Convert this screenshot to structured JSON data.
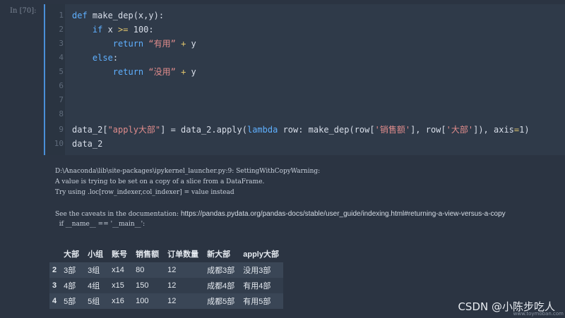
{
  "cell": {
    "prompt": "In [70]:"
  },
  "code_lines": [
    {
      "n": "1",
      "parts": [
        [
          "kw",
          "def "
        ],
        [
          "",
          "make_dep(x,y):"
        ]
      ]
    },
    {
      "n": "2",
      "parts": [
        [
          "",
          "    "
        ],
        [
          "kw",
          "if "
        ],
        [
          "",
          "x "
        ],
        [
          "op",
          ">="
        ],
        [
          "",
          " 100:"
        ]
      ]
    },
    {
      "n": "3",
      "parts": [
        [
          "",
          "        "
        ],
        [
          "kw",
          "return "
        ],
        [
          "str",
          "“有用”"
        ],
        [
          "",
          " "
        ],
        [
          "op",
          "+"
        ],
        [
          "",
          " y"
        ]
      ]
    },
    {
      "n": "4",
      "parts": [
        [
          "",
          "    "
        ],
        [
          "kw",
          "else"
        ],
        [
          "",
          ":"
        ]
      ]
    },
    {
      "n": "5",
      "parts": [
        [
          "",
          "        "
        ],
        [
          "kw",
          "return "
        ],
        [
          "str",
          "“没用”"
        ],
        [
          "",
          " "
        ],
        [
          "op",
          "+"
        ],
        [
          "",
          " y"
        ]
      ]
    },
    {
      "n": "6",
      "parts": []
    },
    {
      "n": "7",
      "parts": []
    },
    {
      "n": "8",
      "parts": []
    },
    {
      "n": "9",
      "parts": [
        [
          "",
          "data_2["
        ],
        [
          "str",
          "\"apply大部\""
        ],
        [
          "",
          "] = data_2.apply("
        ],
        [
          "kw",
          "lambda "
        ],
        [
          "",
          "row: make_dep(row["
        ],
        [
          "str",
          "'销售额'"
        ],
        [
          "",
          "], row["
        ],
        [
          "str",
          "'大部'"
        ],
        [
          "",
          "]), axis"
        ],
        [
          "op",
          "="
        ],
        [
          "",
          "1)"
        ]
      ]
    },
    {
      "n": "10",
      "parts": [
        [
          "",
          "data_2"
        ]
      ]
    }
  ],
  "output": {
    "warning_lines": [
      "D:\\Anaconda\\lib\\site-packages\\ipykernel_launcher.py:9: SettingWithCopyWarning:",
      "A value is trying to be set on a copy of a slice from a DataFrame.",
      "Try using .loc[row_indexer,col_indexer] = value instead"
    ],
    "caveat_prefix": "See the caveats in the documentation: ",
    "caveat_url": "https://pandas.pydata.org/pandas-docs/stable/user_guide/indexing.html#returning-a-view-versus-a-copy",
    "main_line": "  if __name__ == '__main__':"
  },
  "dataframe": {
    "columns": [
      "",
      "大部",
      "小组",
      "账号",
      "销售额",
      "订单数量",
      "新大部",
      "apply大部"
    ],
    "rows": [
      [
        "2",
        "3部",
        "3组",
        "x14",
        "80",
        "12",
        "成都3部",
        "没用3部"
      ],
      [
        "3",
        "4部",
        "4组",
        "x15",
        "150",
        "12",
        "成都4部",
        "有用4部"
      ],
      [
        "4",
        "5部",
        "5组",
        "x16",
        "100",
        "12",
        "成都5部",
        "有用5部"
      ]
    ]
  },
  "watermark": {
    "text": "CSDN @小陈步吃人",
    "sub": "www.toymoban.com"
  }
}
